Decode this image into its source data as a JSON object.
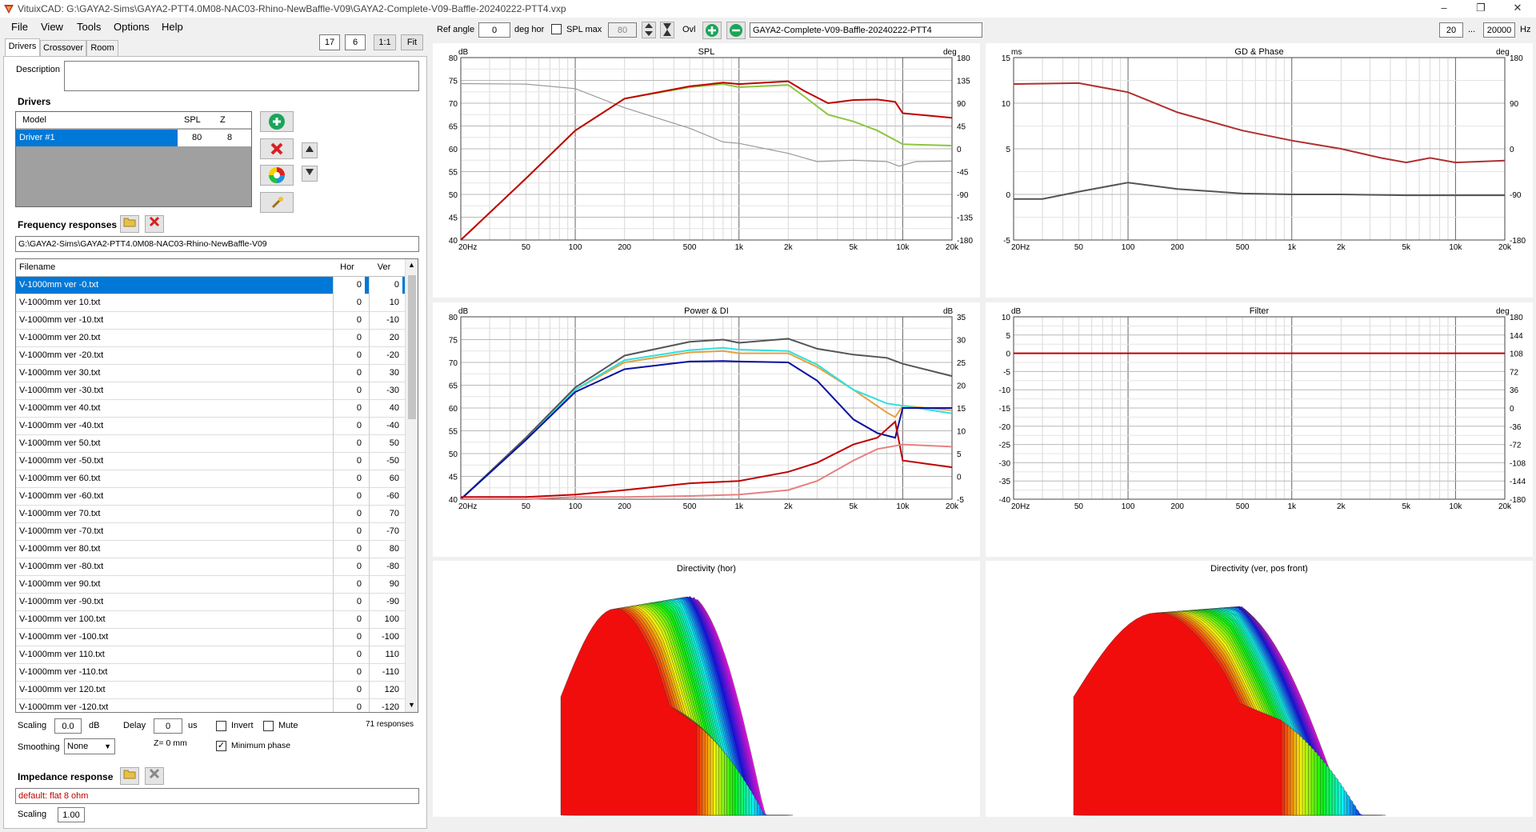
{
  "window": {
    "title": "VituixCAD: G:\\GAYA2-Sims\\GAYA2-PTT4.0M08-NAC03-Rhino-NewBaffle-V09\\GAYA2-Complete-V09-Baffle-20240222-PTT4.vxp",
    "minimize": "–",
    "maximize": "❐",
    "close": "✕"
  },
  "menu": [
    "File",
    "View",
    "Tools",
    "Options",
    "Help"
  ],
  "topbar_left": {
    "a": "17",
    "b": "6",
    "ratio": "1:1",
    "fit": "Fit"
  },
  "tabs": [
    "Drivers",
    "Crossover",
    "Room"
  ],
  "description_label": "Description",
  "drivers": {
    "heading": "Drivers",
    "columns": [
      "Model",
      "SPL",
      "Z"
    ],
    "rows": [
      {
        "model": "Driver #1",
        "spl": "80",
        "z": "8"
      }
    ]
  },
  "freq": {
    "heading": "Frequency responses",
    "path": "G:\\GAYA2-Sims\\GAYA2-PTT4.0M08-NAC03-Rhino-NewBaffle-V09",
    "columns": [
      "Filename",
      "Hor",
      "Ver"
    ],
    "rows": [
      [
        "V-1000mm ver -0.txt",
        "0",
        "0"
      ],
      [
        "V-1000mm ver 10.txt",
        "0",
        "10"
      ],
      [
        "V-1000mm ver -10.txt",
        "0",
        "-10"
      ],
      [
        "V-1000mm ver 20.txt",
        "0",
        "20"
      ],
      [
        "V-1000mm ver -20.txt",
        "0",
        "-20"
      ],
      [
        "V-1000mm ver 30.txt",
        "0",
        "30"
      ],
      [
        "V-1000mm ver -30.txt",
        "0",
        "-30"
      ],
      [
        "V-1000mm ver 40.txt",
        "0",
        "40"
      ],
      [
        "V-1000mm ver -40.txt",
        "0",
        "-40"
      ],
      [
        "V-1000mm ver 50.txt",
        "0",
        "50"
      ],
      [
        "V-1000mm ver -50.txt",
        "0",
        "-50"
      ],
      [
        "V-1000mm ver 60.txt",
        "0",
        "60"
      ],
      [
        "V-1000mm ver -60.txt",
        "0",
        "-60"
      ],
      [
        "V-1000mm ver 70.txt",
        "0",
        "70"
      ],
      [
        "V-1000mm ver -70.txt",
        "0",
        "-70"
      ],
      [
        "V-1000mm ver 80.txt",
        "0",
        "80"
      ],
      [
        "V-1000mm ver -80.txt",
        "0",
        "-80"
      ],
      [
        "V-1000mm ver 90.txt",
        "0",
        "90"
      ],
      [
        "V-1000mm ver -90.txt",
        "0",
        "-90"
      ],
      [
        "V-1000mm ver 100.txt",
        "0",
        "100"
      ],
      [
        "V-1000mm ver -100.txt",
        "0",
        "-100"
      ],
      [
        "V-1000mm ver 110.txt",
        "0",
        "110"
      ],
      [
        "V-1000mm ver -110.txt",
        "0",
        "-110"
      ],
      [
        "V-1000mm ver 120.txt",
        "0",
        "120"
      ],
      [
        "V-1000mm ver -120.txt",
        "0",
        "-120"
      ]
    ],
    "scaling_label": "Scaling",
    "scaling_value": "0.0",
    "scaling_unit": "dB",
    "delay_label": "Delay",
    "delay_value": "0",
    "delay_unit": "us",
    "invert_label": "Invert",
    "mute_label": "Mute",
    "count": "71 responses",
    "smoothing_label": "Smoothing",
    "smoothing_value": "None",
    "z_label": "Z= 0 mm",
    "minphase_label": "Minimum phase"
  },
  "impedance": {
    "heading": "Impedance response",
    "value": "default: flat 8 ohm",
    "scaling_label": "Scaling",
    "scaling_value": "1.00"
  },
  "toolbar": {
    "ref_angle_label": "Ref angle",
    "ref_angle_value": "0",
    "deg_hor": "deg hor",
    "spl_max_label": "SPL max",
    "spl_max_value": "80",
    "ovl_label": "Ovl",
    "overlay_name": "GAYA2-Complete-V09-Baffle-20240222-PTT4",
    "f_min": "20",
    "f_dots": "...",
    "f_max": "20000",
    "hz": "Hz"
  },
  "colors": {
    "dark_red": "#c00000",
    "green": "#8dc63f",
    "gray": "#999999",
    "orange": "#e8a040",
    "cyan": "#30e0e0",
    "navy": "#0a10a0",
    "dark_gray": "#555555",
    "pink": "#e88080",
    "brownred": "#b03030"
  },
  "chart_data": [
    {
      "type": "line",
      "title": "SPL",
      "ylabel_left": "dB",
      "ylabel_right": "deg",
      "x_ticks": [
        "20Hz",
        "50",
        "100",
        "200",
        "500",
        "1k",
        "2k",
        "5k",
        "10k",
        "20k"
      ],
      "y_ticks": [
        "80",
        "75",
        "70",
        "65",
        "60",
        "55",
        "50",
        "45",
        "40"
      ],
      "y2_ticks": [
        "180",
        "135",
        "90",
        "45",
        "0",
        "-45",
        "-90",
        "-135",
        "-180"
      ],
      "ylim": [
        40,
        80
      ],
      "y2lim": [
        -180,
        180
      ],
      "series": [
        {
          "color": "#999999",
          "axis": "left",
          "x": [
            20,
            50,
            100,
            200,
            500,
            800,
            1000,
            2000,
            3000,
            5000,
            8000,
            9500,
            12000,
            20000
          ],
          "y": [
            74.3,
            74.2,
            73.2,
            69,
            64.5,
            61.5,
            61.2,
            59,
            57.2,
            57.5,
            57.2,
            56.2,
            57.2,
            57.3
          ]
        },
        {
          "color": "#8dc63f",
          "axis": "left",
          "x": [
            20,
            50,
            100,
            200,
            500,
            800,
            1000,
            2000,
            2500,
            3500,
            5000,
            7000,
            10000,
            20000
          ],
          "y": [
            40,
            53.5,
            64,
            71,
            73.5,
            74.2,
            73.5,
            74,
            71.5,
            67.5,
            66,
            64,
            61,
            60.7
          ]
        },
        {
          "color": "#c00000",
          "axis": "left",
          "x": [
            20,
            50,
            100,
            200,
            500,
            800,
            1000,
            2000,
            2500,
            3500,
            5000,
            7000,
            9000,
            10000,
            20000
          ],
          "y": [
            40,
            53.5,
            64,
            71,
            73.7,
            74.5,
            74.2,
            74.8,
            72.7,
            70,
            70.7,
            70.8,
            70.3,
            67.8,
            66.8
          ]
        }
      ]
    },
    {
      "type": "line",
      "title": "GD & Phase",
      "ylabel_left": "ms",
      "ylabel_right": "deg",
      "x_ticks": [
        "20Hz",
        "50",
        "100",
        "200",
        "500",
        "1k",
        "2k",
        "5k",
        "10k",
        "20k"
      ],
      "y_ticks": [
        "15",
        "10",
        "5",
        "0",
        "-5"
      ],
      "y2_ticks": [
        "180",
        "90",
        "0",
        "-90",
        "-180"
      ],
      "ylim": [
        -5,
        15
      ],
      "y2lim": [
        -180,
        180
      ],
      "series": [
        {
          "color": "#b03030",
          "axis": "left",
          "x": [
            20,
            50,
            100,
            200,
            500,
            1000,
            2000,
            3500,
            5000,
            7000,
            10000,
            20000
          ],
          "y": [
            12.1,
            12.2,
            11.2,
            9,
            7,
            5.9,
            5,
            4,
            3.5,
            4,
            3.5,
            3.7
          ]
        },
        {
          "color": "#555555",
          "axis": "left",
          "x": [
            20,
            30,
            50,
            100,
            200,
            500,
            1000,
            2000,
            5000,
            20000
          ],
          "y": [
            -0.5,
            -0.5,
            0.3,
            1.3,
            0.6,
            0.1,
            0,
            0,
            -0.1,
            -0.1
          ]
        }
      ]
    },
    {
      "type": "line",
      "title": "Power & DI",
      "ylabel_left": "dB",
      "ylabel_right": "dB",
      "x_ticks": [
        "20Hz",
        "50",
        "100",
        "200",
        "500",
        "1k",
        "2k",
        "5k",
        "10k",
        "20k"
      ],
      "y_ticks": [
        "80",
        "75",
        "70",
        "65",
        "60",
        "55",
        "50",
        "45",
        "40"
      ],
      "y2_ticks": [
        "35",
        "30",
        "25",
        "20",
        "15",
        "10",
        "5",
        "0",
        "-5"
      ],
      "ylim": [
        40,
        80
      ],
      "y2lim": [
        -5,
        35
      ],
      "series": [
        {
          "color": "#555555",
          "axis": "left",
          "x": [
            20,
            50,
            100,
            200,
            500,
            800,
            1000,
            2000,
            3000,
            5000,
            8000,
            10000,
            20000
          ],
          "y": [
            40,
            53.5,
            64.5,
            71.5,
            74.5,
            75,
            74.3,
            75.2,
            73,
            71.7,
            71,
            69.7,
            67
          ]
        },
        {
          "color": "#e8a040",
          "axis": "left",
          "x": [
            20,
            50,
            100,
            200,
            500,
            800,
            1000,
            2000,
            3000,
            5000,
            8000,
            9000,
            10000,
            20000
          ],
          "y": [
            40,
            53,
            64,
            70,
            72.2,
            72.5,
            72,
            72,
            69,
            64,
            59,
            58,
            60.5,
            59.5
          ]
        },
        {
          "color": "#30e0e0",
          "axis": "left",
          "x": [
            20,
            50,
            100,
            200,
            500,
            800,
            1000,
            2000,
            3000,
            5000,
            8000,
            10000,
            20000
          ],
          "y": [
            40,
            53,
            64,
            70.5,
            72.7,
            73.2,
            72.8,
            72.5,
            69.5,
            64,
            61,
            60.5,
            58.8
          ]
        },
        {
          "color": "#0a10a0",
          "axis": "left",
          "x": [
            20,
            50,
            100,
            200,
            500,
            800,
            1000,
            2000,
            3000,
            5000,
            7000,
            9000,
            10000,
            20000
          ],
          "y": [
            40,
            53,
            63.5,
            68.5,
            70.2,
            70.3,
            70.2,
            70,
            66,
            57.5,
            54.5,
            53.5,
            60,
            60
          ]
        },
        {
          "color": "#c00000",
          "axis": "right",
          "x": [
            20,
            50,
            100,
            200,
            500,
            1000,
            2000,
            3000,
            5000,
            7000,
            9000,
            10000,
            20000
          ],
          "y": [
            -4.5,
            -4.5,
            -4,
            -3,
            -1.5,
            -1,
            1,
            3,
            7,
            8.5,
            12,
            3.5,
            2
          ]
        },
        {
          "color": "#e88080",
          "axis": "right",
          "x": [
            20,
            50,
            100,
            200,
            500,
            1000,
            2000,
            3000,
            5000,
            7000,
            10000,
            20000
          ],
          "y": [
            -5,
            -5,
            -4.5,
            -4.5,
            -4.3,
            -4,
            -3,
            -1,
            3.5,
            6,
            7,
            6.5
          ]
        }
      ]
    },
    {
      "type": "line",
      "title": "Filter",
      "ylabel_left": "dB",
      "ylabel_right": "deg",
      "x_ticks": [
        "20Hz",
        "50",
        "100",
        "200",
        "500",
        "1k",
        "2k",
        "5k",
        "10k",
        "20k"
      ],
      "y_ticks": [
        "10",
        "5",
        "0",
        "-5",
        "-10",
        "-15",
        "-20",
        "-25",
        "-30",
        "-35",
        "-40"
      ],
      "y2_ticks": [
        "180",
        "144",
        "108",
        "72",
        "36",
        "0",
        "-36",
        "-72",
        "-108",
        "-144",
        "-180"
      ],
      "ylim": [
        -40,
        10
      ],
      "y2lim": [
        -180,
        180
      ],
      "series": [
        {
          "color": "#c00000",
          "axis": "left",
          "x": [
            20,
            20000
          ],
          "y": [
            0,
            0
          ]
        }
      ]
    }
  ],
  "directivity": {
    "hor_title": "Directivity (hor)",
    "ver_title": "Directivity (ver, pos front)"
  }
}
